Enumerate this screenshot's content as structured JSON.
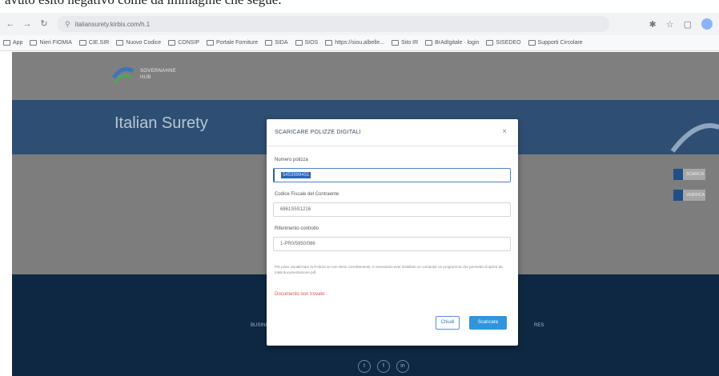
{
  "caption": "avuto esito negativo come da immagine che segue.",
  "browser": {
    "url": "italiansurety.kirbis.com/h.1",
    "bookmarks": [
      "App",
      "Nieri FIOMIA",
      "CIE.SIR",
      "Nuovo Codice",
      "CONSIP",
      "Portale Forniture",
      "SIDA",
      "SIOS",
      "https://siou.albelle...",
      "Sito IR",
      "BrAdIgitale · login",
      "SISEDEO",
      "Supporti Circolare"
    ]
  },
  "header": {
    "brand_line1": "SOVERNAHNE",
    "brand_line2": "HUB"
  },
  "hero": {
    "title": "Italian Surety"
  },
  "side_buttons": [
    "SCARICA",
    "VERIFICA"
  ],
  "modal": {
    "title": "SCARICARE POLIZZE DIGITALI",
    "close_symbol": "×",
    "fields": [
      {
        "label": "Numero polizza",
        "value": "5453999451"
      },
      {
        "label": "Codice Fiscale del Contraente",
        "value": "6861S5S1216"
      },
      {
        "label": "Riferimento controllo",
        "value": "1-PR0/5950/086"
      }
    ],
    "info": "Per poter visualizzare la Polizza se non viene correttamente, è necessario aver installato un computer un programma che permetta di aprire da totali documentazione pdf.",
    "error": "Documento non trovato",
    "buttons": {
      "close": "Chiudi",
      "download": "Scaricare"
    }
  },
  "footer": {
    "text_left": "BUSINE",
    "text_right": "RES"
  },
  "social_icons": [
    "twitter-icon",
    "facebook-icon",
    "linkedin-icon"
  ]
}
